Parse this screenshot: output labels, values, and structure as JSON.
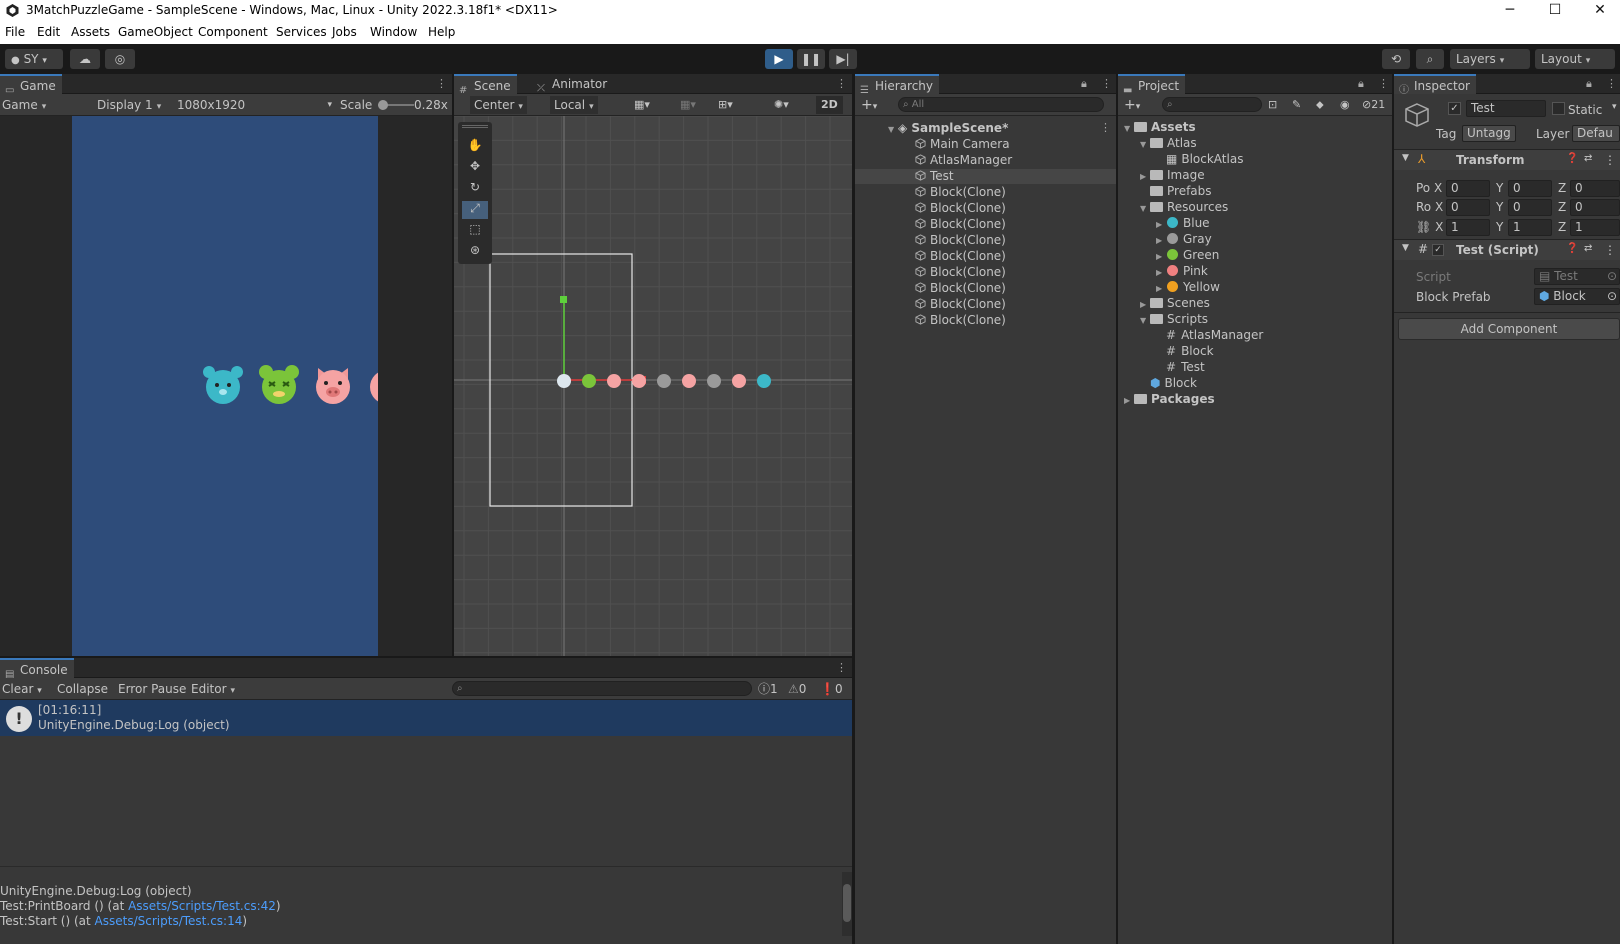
{
  "window": {
    "title": "3MatchPuzzleGame - SampleScene - Windows, Mac, Linux - Unity 2022.3.18f1* <DX11>",
    "minimize": "─",
    "maximize": "☐",
    "close": "✕"
  },
  "menu": [
    "File",
    "Edit",
    "Assets",
    "GameObject",
    "Component",
    "Services",
    "Jobs",
    "Window",
    "Help"
  ],
  "toolbar": {
    "account": "SY",
    "layers": "Layers",
    "layout": "Layout"
  },
  "game": {
    "tab": "Game",
    "mode": "Game",
    "display": "Display 1",
    "resolution": "1080x1920",
    "scale_label": "Scale",
    "scale_value": "0.28x"
  },
  "scene": {
    "tab_scene": "Scene",
    "tab_animator": "Animator",
    "pivot": "Center",
    "space": "Local",
    "mode2d": "2D"
  },
  "hierarchy": {
    "tab": "Hierarchy",
    "search_placeholder": "All",
    "scene_name": "SampleScene*",
    "items": [
      "Main Camera",
      "AtlasManager",
      "Test",
      "Block(Clone)",
      "Block(Clone)",
      "Block(Clone)",
      "Block(Clone)",
      "Block(Clone)",
      "Block(Clone)",
      "Block(Clone)",
      "Block(Clone)",
      "Block(Clone)"
    ],
    "selected": "Test"
  },
  "project": {
    "tab": "Project",
    "hidden_count": "21",
    "tree": [
      {
        "label": "Assets",
        "depth": 0,
        "type": "folder",
        "bold": true,
        "open": true
      },
      {
        "label": "Atlas",
        "depth": 1,
        "type": "folder",
        "open": true
      },
      {
        "label": "BlockAtlas",
        "depth": 2,
        "type": "atlas"
      },
      {
        "label": "Image",
        "depth": 1,
        "type": "folder",
        "open": false
      },
      {
        "label": "Prefabs",
        "depth": 1,
        "type": "folder-empty"
      },
      {
        "label": "Resources",
        "depth": 1,
        "type": "folder",
        "open": true
      },
      {
        "label": "Blue",
        "depth": 2,
        "type": "sprite",
        "color": "#3cb8c8"
      },
      {
        "label": "Gray",
        "depth": 2,
        "type": "sprite",
        "color": "#9a9a9a"
      },
      {
        "label": "Green",
        "depth": 2,
        "type": "sprite",
        "color": "#7bc43a"
      },
      {
        "label": "Pink",
        "depth": 2,
        "type": "sprite",
        "color": "#f08080"
      },
      {
        "label": "Yellow",
        "depth": 2,
        "type": "sprite",
        "color": "#f0a020"
      },
      {
        "label": "Scenes",
        "depth": 1,
        "type": "folder",
        "open": false
      },
      {
        "label": "Scripts",
        "depth": 1,
        "type": "folder",
        "open": true
      },
      {
        "label": "AtlasManager",
        "depth": 2,
        "type": "script"
      },
      {
        "label": "Block",
        "depth": 2,
        "type": "script"
      },
      {
        "label": "Test",
        "depth": 2,
        "type": "script"
      },
      {
        "label": "Block",
        "depth": 1,
        "type": "prefab"
      },
      {
        "label": "Packages",
        "depth": 0,
        "type": "folder",
        "bold": true,
        "open": false
      }
    ]
  },
  "inspector": {
    "tab": "Inspector",
    "object_name": "Test",
    "static_label": "Static",
    "tag_label": "Tag",
    "tag_value": "Untagg",
    "layer_label": "Layer",
    "layer_value": "Defau",
    "transform": {
      "title": "Transform",
      "position_label": "Po X",
      "rotation_label": "Ro X",
      "scale_label": "X",
      "position": [
        "0",
        "0",
        "0"
      ],
      "rotation": [
        "0",
        "0",
        "0"
      ],
      "scale": [
        "1",
        "1",
        "1"
      ],
      "y": "Y",
      "z": "Z"
    },
    "script_component": {
      "title": "Test (Script)",
      "script_label": "Script",
      "script_value": "Test",
      "prefab_label": "Block Prefab",
      "prefab_value": "Block"
    },
    "add_component": "Add Component"
  },
  "console": {
    "tab": "Console",
    "clear": "Clear",
    "collapse": "Collapse",
    "error_pause": "Error Pause",
    "editor": "Editor",
    "counts": {
      "logs": "1",
      "warnings": "0",
      "errors": "0"
    },
    "entry_time": "[01:16:11]",
    "entry_message": "UnityEngine.Debug:Log (object)",
    "detail_line1": "UnityEngine.Debug:Log (object)",
    "detail_line2_prefix": "Test:PrintBoard () (at ",
    "detail_line2_link": "Assets/Scripts/Test.cs:42",
    "detail_line2_suffix": ")",
    "detail_line3_prefix": "Test:Start () (at ",
    "detail_line3_link": "Assets/Scripts/Test.cs:14",
    "detail_line3_suffix": ")"
  },
  "colors": {
    "game_bg": "#2e4c7a",
    "accent": "#3a79bb",
    "link": "#4c9dfc",
    "selected_row": "#1f3a5f"
  }
}
